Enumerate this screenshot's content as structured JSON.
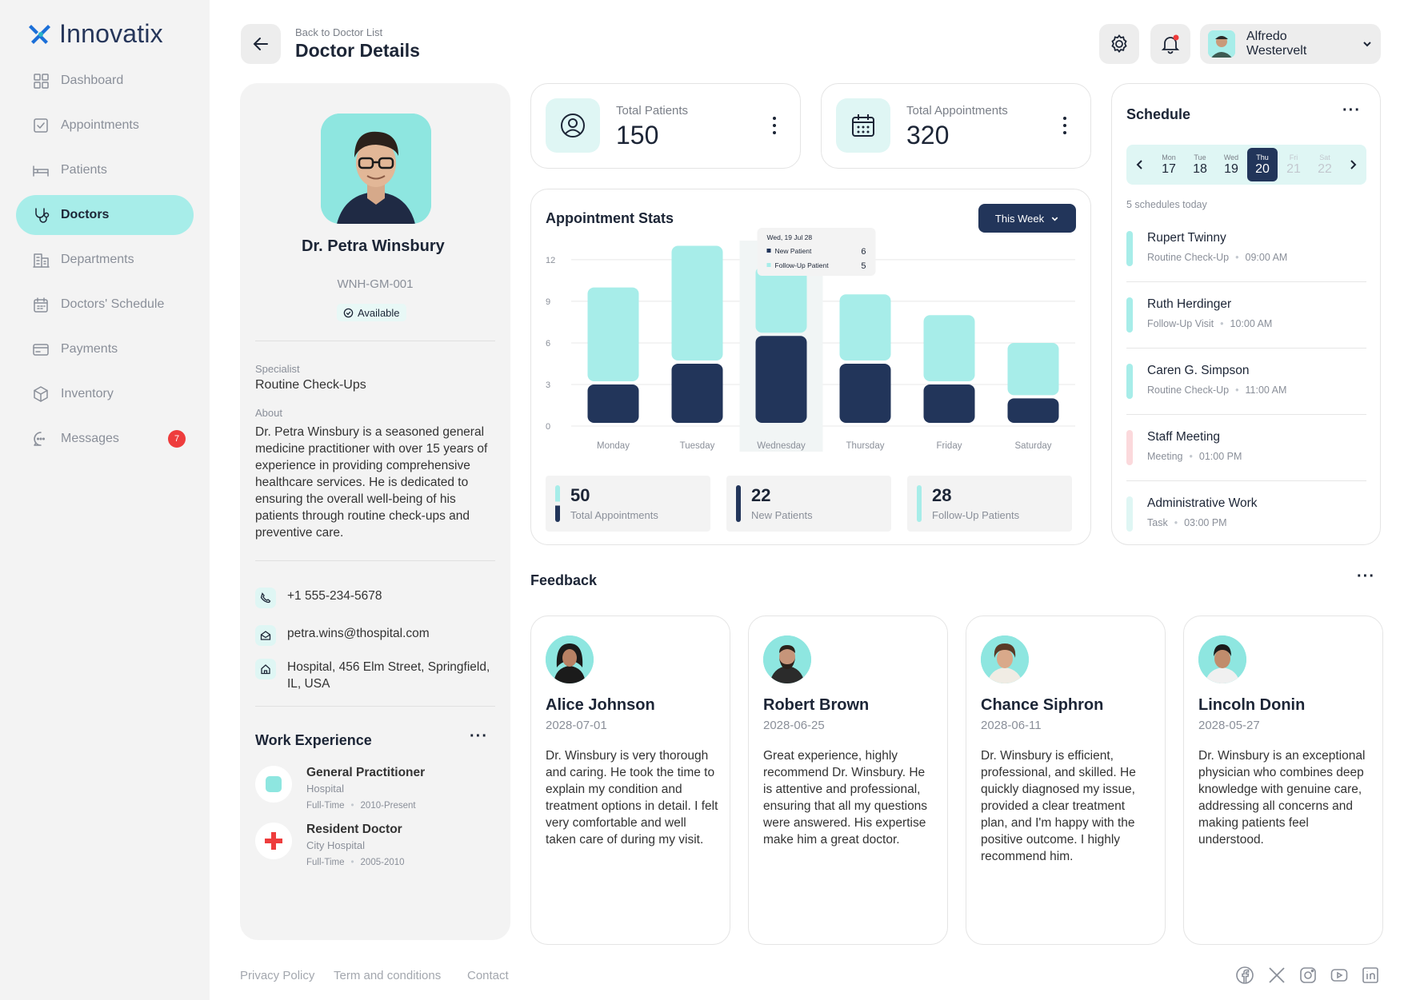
{
  "app": {
    "name": "Innovatix"
  },
  "nav": {
    "items": [
      {
        "label": "Dashboard",
        "icon": "grid-icon"
      },
      {
        "label": "Appointments",
        "icon": "checkbox-icon"
      },
      {
        "label": "Patients",
        "icon": "bed-icon"
      },
      {
        "label": "Doctors",
        "icon": "stethoscope-icon",
        "active": true
      },
      {
        "label": "Departments",
        "icon": "building-icon"
      },
      {
        "label": "Doctors' Schedule",
        "icon": "calendar-icon"
      },
      {
        "label": "Payments",
        "icon": "card-icon"
      },
      {
        "label": "Inventory",
        "icon": "box-icon"
      },
      {
        "label": "Messages",
        "icon": "chat-icon",
        "badge": "7"
      }
    ]
  },
  "header": {
    "breadcrumb": "Back to Doctor List",
    "title": "Doctor Details",
    "user_name": "Alfredo Westervelt"
  },
  "doctor": {
    "name": "Dr. Petra Winsbury",
    "id": "WNH-GM-001",
    "status": "Available",
    "specialist_label": "Specialist",
    "specialist": "Routine Check-Ups",
    "about_label": "About",
    "about": "Dr. Petra Winsbury is a seasoned general medicine practitioner with over 15 years of experience in providing comprehensive healthcare services. He is dedicated to ensuring the overall well-being of his patients through routine check-ups and preventive care.",
    "phone": "+1 555-234-5678",
    "email": "petra.wins@thospital.com",
    "address": "Hospital, 456 Elm Street, Springfield, IL, USA"
  },
  "work": {
    "title": "Work Experience",
    "items": [
      {
        "role": "General Practitioner",
        "place": "Hospital",
        "type": "Full-Time",
        "period": "2010-Present"
      },
      {
        "role": "Resident Doctor",
        "place": "City Hospital",
        "type": "Full-Time",
        "period": "2005-2010"
      }
    ]
  },
  "stats": {
    "patients": {
      "label": "Total Patients",
      "value": "150"
    },
    "appointments": {
      "label": "Total Appointments",
      "value": "320"
    }
  },
  "appt": {
    "title": "Appointment Stats",
    "period": "This Week",
    "tooltip": {
      "date": "Wed, 19 Jul 28",
      "new_label": "New Patient",
      "new_value": "6",
      "follow_label": "Follow-Up Patient",
      "follow_value": "5"
    },
    "summary": [
      {
        "value": "50",
        "label": "Total Appointments"
      },
      {
        "value": "22",
        "label": "New Patients"
      },
      {
        "value": "28",
        "label": "Follow-Up Patients"
      }
    ]
  },
  "chart_data": {
    "type": "bar",
    "stacked": true,
    "categories": [
      "Monday",
      "Tuesday",
      "Wednesday",
      "Thursday",
      "Friday",
      "Saturday"
    ],
    "series": [
      {
        "name": "New Patient",
        "values": [
          3,
          4.5,
          6.5,
          4.5,
          3,
          2
        ],
        "color": "#22355a"
      },
      {
        "name": "Follow-Up Patient",
        "values": [
          7,
          8.5,
          5,
          5,
          5,
          4
        ],
        "color": "#a7ede9"
      }
    ],
    "yticks": [
      0,
      3,
      6,
      9,
      12
    ],
    "ylim": [
      0,
      12.8
    ],
    "highlight": "Wednesday"
  },
  "schedule": {
    "title": "Schedule",
    "count_text": "5 schedules today",
    "days": [
      {
        "dn": "Mon",
        "dv": "17"
      },
      {
        "dn": "Tue",
        "dv": "18"
      },
      {
        "dn": "Wed",
        "dv": "19"
      },
      {
        "dn": "Thu",
        "dv": "20",
        "sel": true
      },
      {
        "dn": "Fri",
        "dv": "21",
        "off": true
      },
      {
        "dn": "Sat",
        "dv": "22",
        "off": true
      }
    ],
    "items": [
      {
        "name": "Rupert Twinny",
        "type": "Routine Check-Up",
        "time": "09:00 AM",
        "color": "#a7ede9"
      },
      {
        "name": "Ruth Herdinger",
        "type": "Follow-Up Visit",
        "time": "10:00 AM",
        "color": "#a7ede9"
      },
      {
        "name": "Caren G. Simpson",
        "type": "Routine Check-Up",
        "time": "11:00 AM",
        "color": "#a7ede9"
      },
      {
        "name": "Staff Meeting",
        "type": "Meeting",
        "time": "01:00 PM",
        "color": "#fbd9dc"
      },
      {
        "name": "Administrative Work",
        "type": "Task",
        "time": "03:00 PM",
        "color": "#dff6f4"
      }
    ]
  },
  "feedback": {
    "title": "Feedback",
    "items": [
      {
        "name": "Alice Johnson",
        "date": "2028-07-01",
        "text": "Dr. Winsbury is very thorough and caring. He took the time to explain my condition and treatment options in detail. I felt very comfortable and well taken care of during my visit."
      },
      {
        "name": "Robert Brown",
        "date": "2028-06-25",
        "text": "Great experience, highly recommend Dr. Winsbury. He is attentive and professional, ensuring that all my questions were answered. His expertise make him a great doctor."
      },
      {
        "name": "Chance Siphron",
        "date": "2028-06-11",
        "text": "Dr. Winsbury is efficient, professional, and skilled. He quickly diagnosed my issue, provided a clear treatment plan, and I'm happy with the positive outcome. I highly recommend him."
      },
      {
        "name": "Lincoln Donin",
        "date": "2028-05-27",
        "text": "Dr. Winsbury is an exceptional physician who combines deep knowledge with genuine care, addressing all concerns and making patients feel understood."
      }
    ]
  },
  "footer": {
    "links": [
      "Privacy Policy",
      "Term and conditions",
      "Contact"
    ]
  }
}
